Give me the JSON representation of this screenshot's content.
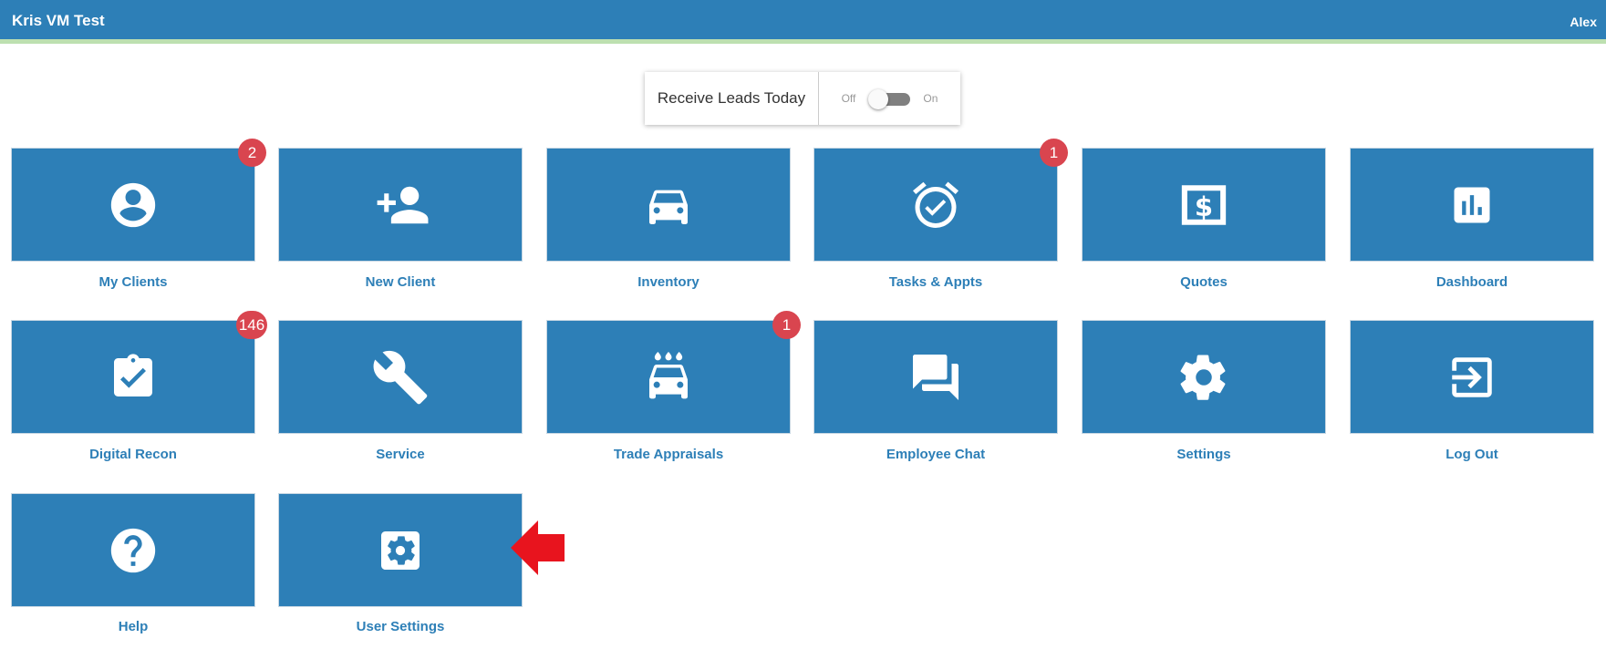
{
  "header": {
    "title": "Kris VM Test",
    "user": "Alex"
  },
  "leads": {
    "label": "Receive Leads Today",
    "off": "Off",
    "on": "On",
    "enabled": false
  },
  "tiles": [
    {
      "label": "My Clients",
      "icon": "account-circle-icon",
      "badge": "2"
    },
    {
      "label": "New Client",
      "icon": "person-add-icon"
    },
    {
      "label": "Inventory",
      "icon": "car-icon"
    },
    {
      "label": "Tasks & Appts",
      "icon": "alarm-check-icon",
      "badge": "1"
    },
    {
      "label": "Quotes",
      "icon": "money-icon"
    },
    {
      "label": "Dashboard",
      "icon": "bar-chart-icon"
    },
    {
      "label": "Digital Recon",
      "icon": "clipboard-check-icon",
      "badge": "146"
    },
    {
      "label": "Service",
      "icon": "wrench-icon"
    },
    {
      "label": "Trade Appraisals",
      "icon": "car-wash-icon",
      "badge": "1"
    },
    {
      "label": "Employee Chat",
      "icon": "forum-icon"
    },
    {
      "label": "Settings",
      "icon": "gear-icon"
    },
    {
      "label": "Log Out",
      "icon": "exit-icon"
    },
    {
      "label": "Help",
      "icon": "help-icon"
    },
    {
      "label": "User Settings",
      "icon": "user-settings-icon"
    }
  ],
  "colors": {
    "brand": "#2d7fb7",
    "badge": "#d9454f",
    "arrow": "#e8141e",
    "accent_line": "#bde0b0"
  }
}
